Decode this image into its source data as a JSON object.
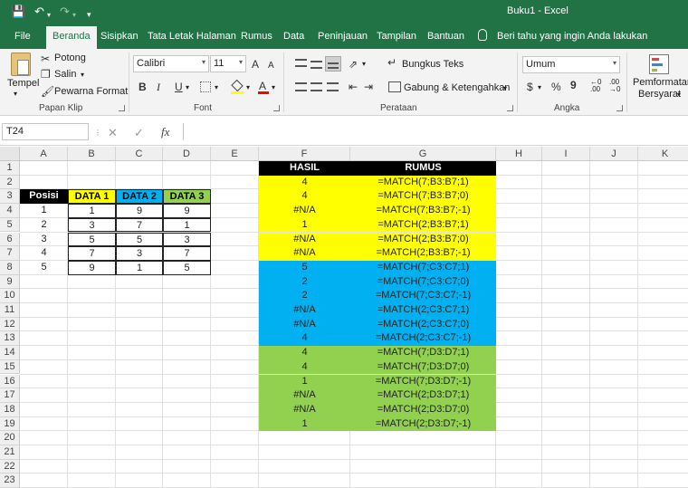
{
  "colors": {
    "excel_green": "#217346",
    "yellow": "#ffff00",
    "blue": "#00b0f0",
    "green": "#92d050",
    "black": "#000000"
  },
  "titlebar": {
    "title": "Buku1  -  Excel",
    "icons": [
      "save-icon",
      "undo-icon",
      "redo-icon",
      "customize-icon"
    ]
  },
  "tabs": [
    "File",
    "Beranda",
    "Sisipkan",
    "Tata Letak Halaman",
    "Rumus",
    "Data",
    "Peninjauan",
    "Tampilan",
    "Bantuan"
  ],
  "tellme": "Beri tahu yang ingin Anda lakukan",
  "ribbon": {
    "clipboard": {
      "paste": "Tempel",
      "cut": "Potong",
      "copy": "Salin",
      "format_painter": "Pewarna Format",
      "label": "Papan Klip"
    },
    "font": {
      "name": "Calibri",
      "size": "11",
      "grow": "A",
      "shrink": "A",
      "bold": "B",
      "italic": "I",
      "underline": "U",
      "font_color": "A",
      "label": "Font"
    },
    "alignment": {
      "wrap": "Bungkus Teks",
      "merge": "Gabung & Ketengahkan",
      "label": "Perataan"
    },
    "number": {
      "format": "Umum",
      "currency": "$",
      "percent": "%",
      "comma": "9",
      "inc_decimal": "←0 .00",
      "dec_decimal": ".00 →0",
      "label": "Angka"
    },
    "styles": {
      "conditional": "Pemformatan",
      "conditional2": "Bersyarat"
    }
  },
  "formula_bar": {
    "name_box": "T24",
    "fx": "fx",
    "cancel": "✕",
    "enter": "✓",
    "formula": ""
  },
  "columns": [
    "A",
    "B",
    "C",
    "D",
    "E",
    "F",
    "G",
    "H",
    "I",
    "J",
    "K"
  ],
  "rows": [
    "1",
    "2",
    "3",
    "4",
    "5",
    "6",
    "7",
    "8",
    "9",
    "10",
    "11",
    "12",
    "13",
    "14",
    "15",
    "16",
    "17",
    "18",
    "19",
    "20",
    "21",
    "22",
    "23"
  ],
  "table": {
    "headers": [
      "Posisi",
      "DATA 1",
      "DATA 2",
      "DATA 3"
    ],
    "rows": [
      [
        "1",
        "1",
        "9",
        "9"
      ],
      [
        "2",
        "3",
        "7",
        "1"
      ],
      [
        "3",
        "5",
        "5",
        "3"
      ],
      [
        "4",
        "7",
        "3",
        "7"
      ],
      [
        "5",
        "9",
        "1",
        "5"
      ]
    ]
  },
  "results": {
    "header_hasil": "HASIL",
    "header_rumus": "RUMUS",
    "rows": [
      {
        "hasil": "4",
        "rumus": "=MATCH(7;B3:B7;1)"
      },
      {
        "hasil": "4",
        "rumus": "=MATCH(7;B3:B7;0)"
      },
      {
        "hasil": "#N/A",
        "rumus": "=MATCH(7;B3:B7;-1)"
      },
      {
        "hasil": "1",
        "rumus": "=MATCH(2;B3:B7;1)"
      },
      {
        "hasil": "#N/A",
        "rumus": "=MATCH(2;B3:B7;0)"
      },
      {
        "hasil": "#N/A",
        "rumus": "=MATCH(2;B3:B7;-1)"
      },
      {
        "hasil": "5",
        "rumus": "=MATCH(7;C3:C7;1)"
      },
      {
        "hasil": "2",
        "rumus": "=MATCH(7;C3:C7;0)"
      },
      {
        "hasil": "2",
        "rumus": "=MATCH(7;C3:C7;-1)"
      },
      {
        "hasil": "#N/A",
        "rumus": "=MATCH(2;C3:C7;1)"
      },
      {
        "hasil": "#N/A",
        "rumus": "=MATCH(2;C3:C7;0)"
      },
      {
        "hasil": "4",
        "rumus": "=MATCH(2;C3:C7;-1)"
      },
      {
        "hasil": "4",
        "rumus": "=MATCH(7;D3:D7;1)"
      },
      {
        "hasil": "4",
        "rumus": "=MATCH(7;D3:D7;0)"
      },
      {
        "hasil": "1",
        "rumus": "=MATCH(7;D3:D7;-1)"
      },
      {
        "hasil": "#N/A",
        "rumus": "=MATCH(2;D3:D7;1)"
      },
      {
        "hasil": "#N/A",
        "rumus": "=MATCH(2;D3:D7;0)"
      },
      {
        "hasil": "1",
        "rumus": "=MATCH(2;D3:D7;-1)"
      }
    ]
  }
}
